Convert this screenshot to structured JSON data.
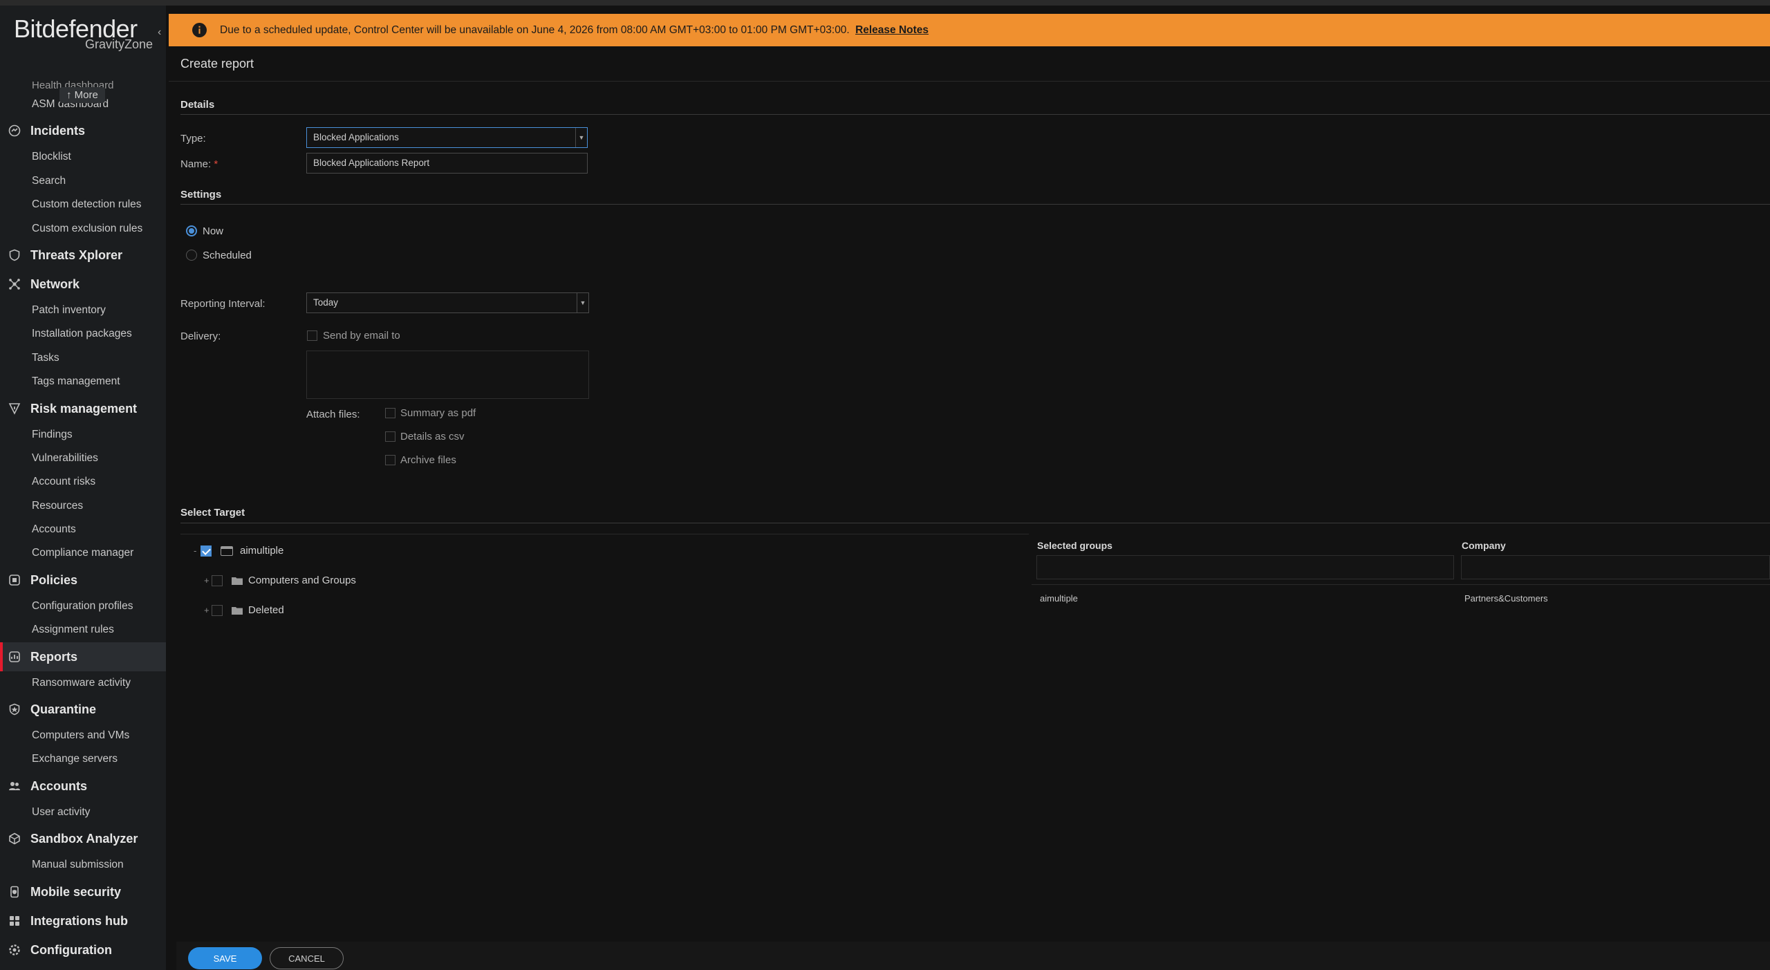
{
  "brand": {
    "name": "Bitdefender",
    "product": "GravityZone"
  },
  "sidebar": {
    "more_label": "↑ More",
    "cut_item": "Health dashboard",
    "items": [
      {
        "kind": "sub",
        "label": "ASM dashboard"
      },
      {
        "kind": "head",
        "label": "Incidents",
        "icon": "incidents-icon"
      },
      {
        "kind": "sub",
        "label": "Blocklist"
      },
      {
        "kind": "sub",
        "label": "Search"
      },
      {
        "kind": "sub",
        "label": "Custom detection rules"
      },
      {
        "kind": "sub",
        "label": "Custom exclusion rules"
      },
      {
        "kind": "head",
        "label": "Threats Xplorer",
        "icon": "shield-icon"
      },
      {
        "kind": "head",
        "label": "Network",
        "icon": "network-icon"
      },
      {
        "kind": "sub",
        "label": "Patch inventory"
      },
      {
        "kind": "sub",
        "label": "Installation packages"
      },
      {
        "kind": "sub",
        "label": "Tasks"
      },
      {
        "kind": "sub",
        "label": "Tags management"
      },
      {
        "kind": "head",
        "label": "Risk management",
        "icon": "risk-icon"
      },
      {
        "kind": "sub",
        "label": "Findings"
      },
      {
        "kind": "sub",
        "label": "Vulnerabilities"
      },
      {
        "kind": "sub",
        "label": "Account risks"
      },
      {
        "kind": "sub",
        "label": "Resources"
      },
      {
        "kind": "sub",
        "label": "Accounts"
      },
      {
        "kind": "sub",
        "label": "Compliance manager"
      },
      {
        "kind": "head",
        "label": "Policies",
        "icon": "policies-icon"
      },
      {
        "kind": "sub",
        "label": "Configuration profiles"
      },
      {
        "kind": "sub",
        "label": "Assignment rules"
      },
      {
        "kind": "head",
        "label": "Reports",
        "icon": "reports-icon",
        "active": true
      },
      {
        "kind": "sub",
        "label": "Ransomware activity"
      },
      {
        "kind": "head",
        "label": "Quarantine",
        "icon": "quarantine-icon"
      },
      {
        "kind": "sub",
        "label": "Computers and VMs"
      },
      {
        "kind": "sub",
        "label": "Exchange servers"
      },
      {
        "kind": "head",
        "label": "Accounts",
        "icon": "accounts-icon"
      },
      {
        "kind": "sub",
        "label": "User activity"
      },
      {
        "kind": "head",
        "label": "Sandbox Analyzer",
        "icon": "sandbox-icon"
      },
      {
        "kind": "sub",
        "label": "Manual submission"
      },
      {
        "kind": "head",
        "label": "Mobile security",
        "icon": "mobile-security-icon"
      },
      {
        "kind": "head",
        "label": "Integrations hub",
        "icon": "integrations-icon"
      },
      {
        "kind": "head",
        "label": "Configuration",
        "icon": "configuration-icon"
      }
    ]
  },
  "banner": {
    "text": "Due to a scheduled update, Control Center will be unavailable on June 4, 2026 from 08:00 AM GMT+03:00 to 01:00 PM GMT+03:00.",
    "link": "Release Notes",
    "color": "#f0902f"
  },
  "page": {
    "title": "Create report"
  },
  "details": {
    "section": "Details",
    "type_label": "Type:",
    "type_value": "Blocked Applications",
    "name_label": "Name:",
    "name_required_mark": "*",
    "name_value": "Blocked Applications Report"
  },
  "settings": {
    "section": "Settings",
    "now_label": "Now",
    "scheduled_label": "Scheduled",
    "selected": "Now",
    "interval_label": "Reporting Interval:",
    "interval_value": "Today",
    "delivery_label": "Delivery:",
    "send_email_label": "Send by email to",
    "attach_label": "Attach files:",
    "attach_options": [
      "Summary as pdf",
      "Details as csv",
      "Archive files"
    ]
  },
  "target": {
    "section": "Select Target",
    "tree": [
      {
        "label": "aimultiple",
        "checked": true,
        "toggle": "-"
      },
      {
        "label": "Computers and Groups",
        "checked": false,
        "toggle": "+"
      },
      {
        "label": "Deleted",
        "checked": false,
        "toggle": "+"
      }
    ],
    "columns": [
      "Selected groups",
      "Company"
    ],
    "rows": [
      {
        "group": "aimultiple",
        "company": "Partners&Customers"
      }
    ]
  },
  "footer": {
    "save": "SAVE",
    "cancel": "CANCEL"
  },
  "colors": {
    "accent": "#4a90d9",
    "active_marker": "#e31b2d",
    "save_button": "#2a8ce0"
  }
}
